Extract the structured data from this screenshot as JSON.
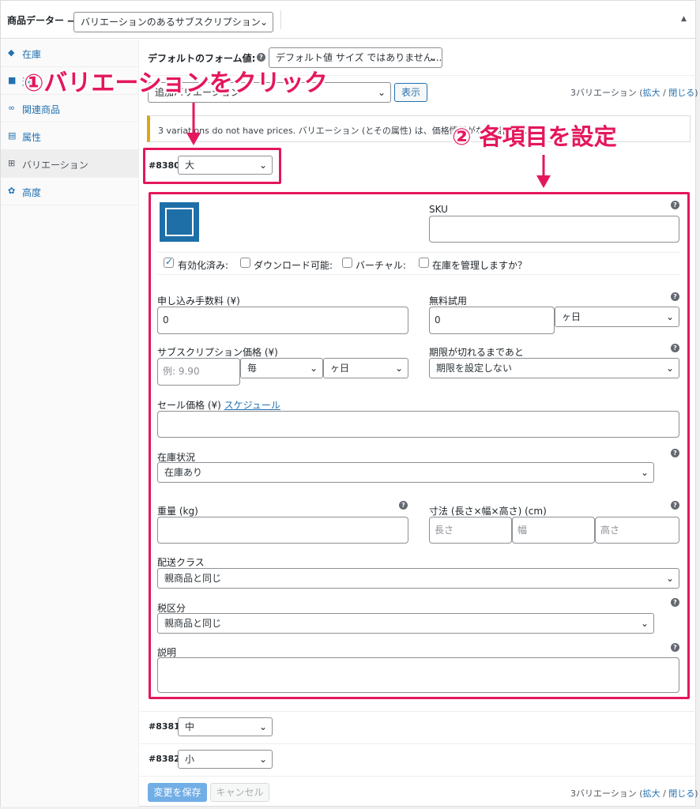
{
  "header": {
    "title": "商品データー —",
    "product_type": "バリエーションのあるサブスクリプション"
  },
  "sidebar": {
    "items": [
      {
        "icon": "tag-icon",
        "glyph": "◆",
        "label": "在庫"
      },
      {
        "icon": "truck-icon",
        "glyph": "■",
        "label": "送"
      },
      {
        "icon": "link-icon",
        "glyph": "∞",
        "label": "関連商品"
      },
      {
        "icon": "list-icon",
        "glyph": "▤",
        "label": "属性"
      },
      {
        "icon": "grid-icon",
        "glyph": "⊞",
        "label": "バリエーション"
      },
      {
        "icon": "gear-icon",
        "glyph": "✿",
        "label": "高度"
      }
    ]
  },
  "defaults": {
    "label": "デフォルトのフォーム値:",
    "select_value": "デフォルト値 サイズ ではありません..."
  },
  "toolbar": {
    "add_select": "追加バリエーション",
    "show_button": "表示",
    "count_text": "3バリエーション (",
    "expand": "拡大",
    "slash": " / ",
    "close": "閉じる",
    "paren": ")"
  },
  "notice": "3 variations do not have prices. バリエーション (とその属性) は、価格情報がない場合は...",
  "variations": [
    {
      "id": "#8380",
      "size": "大"
    },
    {
      "id": "#8381",
      "size": "中"
    },
    {
      "id": "#8382",
      "size": "小"
    }
  ],
  "form": {
    "sku_label": "SKU",
    "enabled_label": "有効化済み:",
    "downloadable_label": "ダウンロード可能:",
    "virtual_label": "バーチャル:",
    "manage_stock_label": "在庫を管理しますか？",
    "signup_fee_label": "申し込み手数料 (¥)",
    "signup_fee_value": "0",
    "free_trial_label": "無料試用",
    "free_trial_value": "0",
    "free_trial_unit": "ヶ日",
    "price_label": "サブスクリプション価格 (¥)",
    "price_placeholder": "例: 9.90",
    "period_interval": "毎",
    "period_unit": "ヶ日",
    "expire_label": "期限が切れるまであと",
    "expire_value": "期限を設定しない",
    "sale_label": "セール価格 (¥)",
    "schedule_link": "スケジュール",
    "stock_status_label": "在庫状況",
    "stock_status_value": "在庫あり",
    "weight_label": "重量 (kg)",
    "dimensions_label": "寸法 (長さ×幅×高さ) (cm)",
    "length_ph": "長さ",
    "width_ph": "幅",
    "height_ph": "高さ",
    "shipping_label": "配送クラス",
    "shipping_value": "親商品と同じ",
    "tax_label": "税区分",
    "tax_value": "親商品と同じ",
    "desc_label": "説明"
  },
  "footer": {
    "save": "変更を保存",
    "cancel": "キャンセル"
  },
  "annotations": {
    "step1": "①バリエーションをクリック",
    "step2": "② 各項目を設定"
  },
  "colors": {
    "accent": "#2271b1",
    "annotation": "#e4175c"
  }
}
